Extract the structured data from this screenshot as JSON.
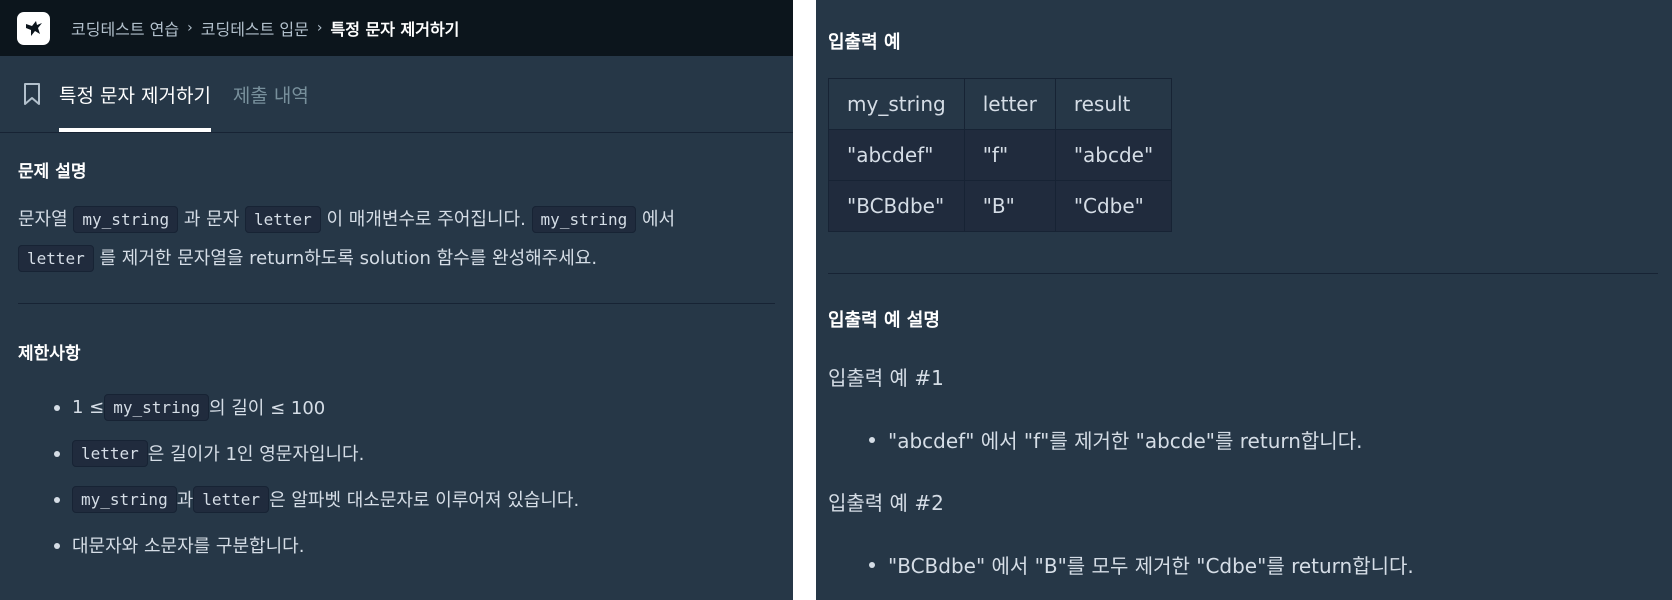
{
  "breadcrumb": {
    "items": [
      "코딩테스트 연습",
      "코딩테스트 입문"
    ],
    "current": "특정 문자 제거하기",
    "separator": "›"
  },
  "tabs": [
    {
      "label": "특정 문자 제거하기",
      "active": true
    },
    {
      "label": "제출 내역",
      "active": false
    }
  ],
  "description": {
    "heading": "문제 설명",
    "p1": {
      "t1": "문자열 ",
      "c1": "my_string",
      "t2": " 과 문자 ",
      "c2": "letter",
      "t3": " 이 매개변수로 주어집니다. ",
      "c3": "my_string",
      "t4": " 에서"
    },
    "p2": {
      "c1": "letter",
      "t1": " 를 제거한 문자열을 return하도록 solution 함수를 완성해주세요."
    }
  },
  "constraints": {
    "heading": "제한사항",
    "items": [
      {
        "t1": "1 ≤ ",
        "c1": "my_string",
        "t2": " 의 길이 ≤ 100"
      },
      {
        "c1": "letter",
        "t1": " 은 길이가 1인 영문자입니다."
      },
      {
        "c1": "my_string",
        "t1": " 과 ",
        "c2": "letter",
        "t2": " 은 알파벳 대소문자로 이루어져 있습니다."
      },
      {
        "t1": "대문자와 소문자를 구분합니다."
      }
    ]
  },
  "examples": {
    "heading": "입출력 예",
    "headers": [
      "my_string",
      "letter",
      "result"
    ],
    "rows": [
      [
        "\"abcdef\"",
        "\"f\"",
        "\"abcde\""
      ],
      [
        "\"BCBdbe\"",
        "\"B\"",
        "\"Cdbe\""
      ]
    ]
  },
  "explanation": {
    "heading": "입출력 예 설명",
    "ex1_title": "입출력 예 #1",
    "ex1_text": "\"abcdef\" 에서 \"f\"를 제거한 \"abcde\"를 return합니다.",
    "ex2_title": "입출력 예 #2",
    "ex2_text": "\"BCBdbe\" 에서 \"B\"를 모두 제거한 \"Cdbe\"를 return합니다."
  },
  "icons": {
    "logo": "programmers-bird-logo",
    "bookmark": "bookmark-icon"
  },
  "colors": {
    "panel_bg": "#263747",
    "topbar_bg": "#0c151c",
    "code_bg": "#202b3d",
    "text": "#d5dde6",
    "muted": "#78909c"
  }
}
